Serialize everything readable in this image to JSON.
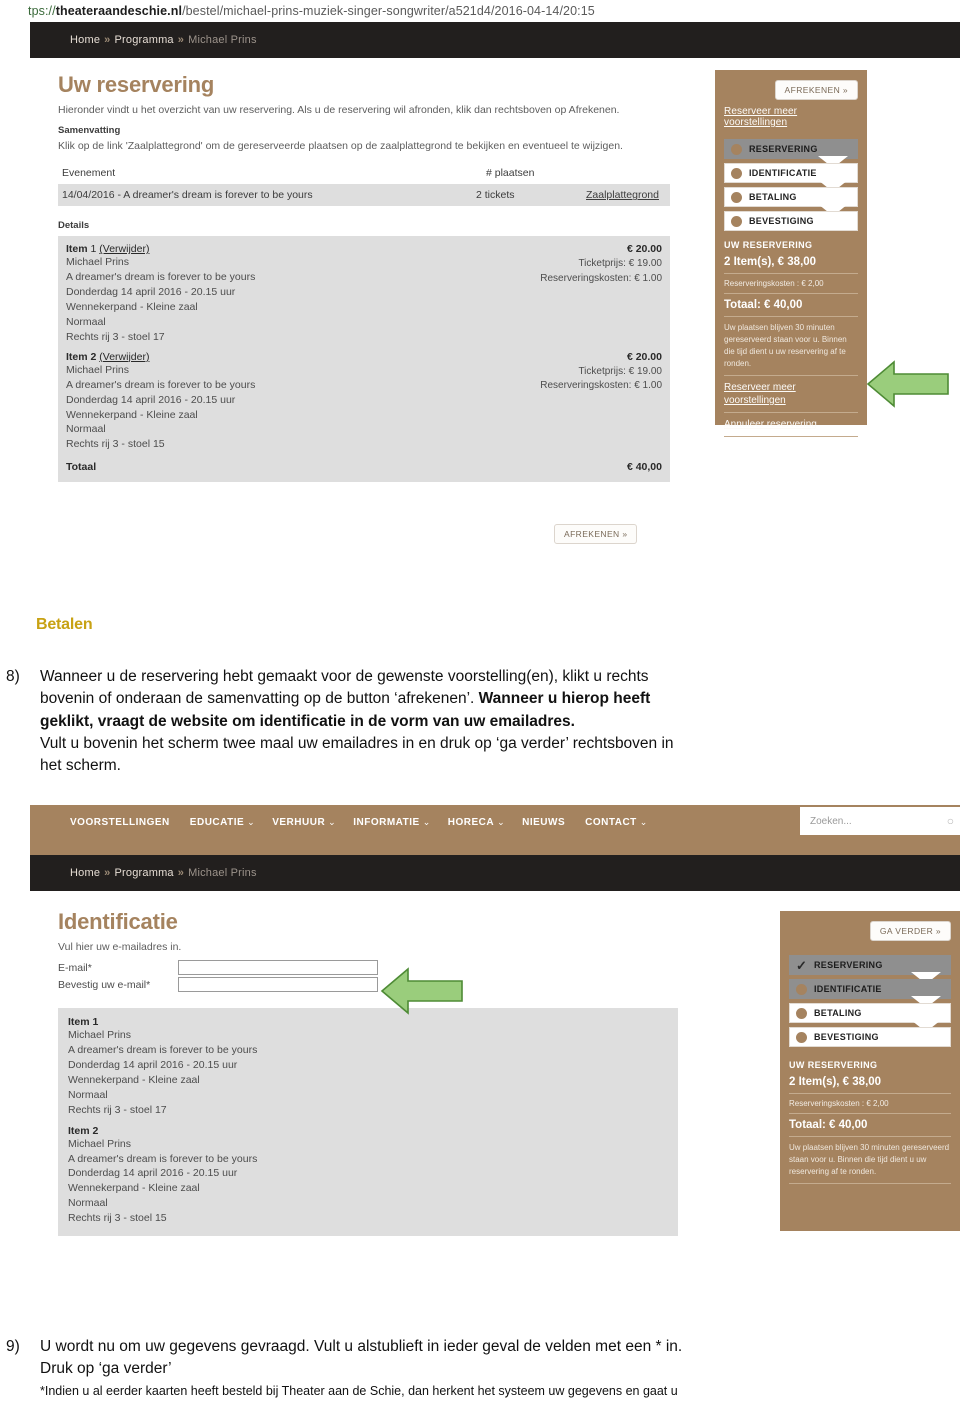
{
  "url": {
    "scheme": "tps://",
    "host": "theateraandeschie.nl",
    "path": "/bestel/michael-prins-muziek-singer-songwriter/a521d4/2016-04-14/20:15",
    "full": "tps://theateraandeschie.nl/bestel/michael-prins-muziek-singer-songwriter/a521d4/2016-04-14/20:15"
  },
  "breadcrumb": {
    "home": "Home",
    "sep": "»",
    "programma": "Programma",
    "current": "Michael Prins"
  },
  "screenshot1": {
    "title": "Uw reservering",
    "lead": "Hieronder vindt u het overzicht van uw reservering. Als u de reservering wil afronden, klik dan rechtsboven op Afrekenen.",
    "summary_label": "Samenvatting",
    "summary_text": "Klik op de link 'Zaalplattegrond' om de gereserveerde plaatsen op de zaalplattegrond te bekijken en eventueel te wijzigen.",
    "table": {
      "headers": [
        "Evenement",
        "# plaatsen"
      ],
      "row": {
        "event": "14/04/2016 - A dreamer's dream is forever to be yours",
        "seats": "2 tickets",
        "maplink": "Zaalplattegrond"
      }
    },
    "details_label": "Details",
    "items": [
      {
        "title_bold": "Item",
        "title_num": "1",
        "remove": "(Verwijder)",
        "price": "€ 20.00",
        "lines": [
          "Michael Prins",
          "A dreamer's dream is forever to be yours",
          "Donderdag 14 april 2016 - 20.15 uur",
          "Wennekerpand - Kleine zaal",
          "Normaal",
          "Rechts rij 3 - stoel 17"
        ],
        "ticketprice": "Ticketprijs: € 19.00",
        "reskosten": "Reserveringskosten: € 1.00"
      },
      {
        "title_bold": "Item 2",
        "title_num": "",
        "remove": "(Verwijder)",
        "price": "€ 20.00",
        "lines": [
          "Michael Prins",
          "A dreamer's dream is forever to be yours",
          "Donderdag 14 april 2016 - 20.15 uur",
          "Wennekerpand - Kleine zaal",
          "Normaal",
          "Rechts rij 3 - stoel 15"
        ],
        "ticketprice": "Ticketprijs: € 19.00",
        "reskosten": "Reserveringskosten: € 1.00"
      }
    ],
    "total_label": "Totaal",
    "total_value": "€ 40,00",
    "bottom_button": "AFREKENEN »",
    "sidebar": {
      "checkout_button": "AFREKENEN »",
      "more_link": "Reserveer meer voorstellingen",
      "steps": [
        {
          "label": "RESERVERING",
          "state": "active"
        },
        {
          "label": "IDENTIFICATIE",
          "state": "todo"
        },
        {
          "label": "BETALING",
          "state": "todo"
        },
        {
          "label": "BEVESTIGING",
          "state": "todo"
        }
      ],
      "summary_title": "UW RESERVERING",
      "items_line": "2 Item(s), € 38,00",
      "fees_line": "Reserveringskosten : € 2,00",
      "total_line": "Totaal: € 40,00",
      "note": "Uw plaatsen blijven 30 minuten gereserveerd staan voor u. Binnen die tijd dient u uw reservering af te ronden.",
      "link_more_1": "Reserveer meer",
      "link_more_2": "voorstellingen",
      "link_cancel": "Annuleer reservering"
    }
  },
  "body": {
    "heading": "Betalen",
    "step8": {
      "number": "8)",
      "line1_a": "Wanneer u de reservering hebt gemaakt voor de gewenste voorstelling(en), klikt u rechts",
      "line2_a": "bovenin of onderaan de samenvatting op de button ‘afrekenen’. ",
      "line2_b": "Wanneer u hierop heeft",
      "line3_b": "geklikt, vraagt de website om identificatie in de vorm van uw emailadres.",
      "line4": "Vult u bovenin het scherm twee maal uw emailadres in en druk op ‘ga verder’ rechtsboven in",
      "line5": "het scherm."
    },
    "step9": {
      "number": "9)",
      "line1": "U wordt nu om uw gegevens gevraagd. Vult u alstublieft in ieder geval de velden met een * in.",
      "line2": "Druk op ‘ga verder’",
      "footnote": "*Indien u al eerder kaarten heeft besteld bij Theater aan de Schie, dan herkent het systeem uw gegevens en gaat u"
    }
  },
  "screenshot2": {
    "nav": [
      {
        "label": "VOORSTELLINGEN",
        "caret": ""
      },
      {
        "label": "EDUCATIE",
        "caret": "⌄"
      },
      {
        "label": "VERHUUR",
        "caret": "⌄"
      },
      {
        "label": "INFORMATIE",
        "caret": "⌄"
      },
      {
        "label": "HORECA",
        "caret": "⌄"
      },
      {
        "label": "NIEUWS",
        "caret": ""
      },
      {
        "label": "CONTACT",
        "caret": "⌄"
      }
    ],
    "search_placeholder": "Zoeken...",
    "search_icon": "search-icon",
    "title": "Identificatie",
    "subtitle": "Vul hier uw e-mailadres in.",
    "fields": [
      {
        "label": "E-mail*",
        "value": ""
      },
      {
        "label": "Bevestig uw e-mail*",
        "value": ""
      }
    ],
    "items": [
      {
        "title": "Item 1",
        "lines": [
          "Michael Prins",
          "A dreamer's dream is forever to be yours",
          "Donderdag 14 april 2016 - 20.15 uur",
          "Wennekerpand - Kleine zaal",
          "Normaal",
          "Rechts rij 3 - stoel 17"
        ]
      },
      {
        "title": "Item 2",
        "lines": [
          "Michael Prins",
          "A dreamer's dream is forever to be yours",
          "Donderdag 14 april 2016 - 20.15 uur",
          "Wennekerpand - Kleine zaal",
          "Normaal",
          "Rechts rij 3 - stoel 15"
        ]
      }
    ],
    "sidebar": {
      "next_button": "GA VERDER »",
      "steps": [
        {
          "label": "RESERVERING",
          "state": "done"
        },
        {
          "label": "IDENTIFICATIE",
          "state": "active"
        },
        {
          "label": "BETALING",
          "state": "todo"
        },
        {
          "label": "BEVESTIGING",
          "state": "todo"
        }
      ],
      "check_glyph": "✓",
      "summary_title": "UW RESERVERING",
      "items_line": "2 Item(s), € 38,00",
      "fees_line": "Reserveringskosten : € 2,00",
      "total_line": "Totaal: € 40,00",
      "note": "Uw plaatsen blijven 30 minuten gereserveerd staan voor u. Binnen die tijd dient u uw reservering af te ronden."
    }
  },
  "colors": {
    "brand_brown": "#a5835f",
    "dark_bar": "#221f1e",
    "heading_yellow": "#c8a213",
    "panel_grey": "#dedede",
    "arrow_green": "#9acd7c",
    "arrow_green_border": "#4e8b35",
    "step_active_grey": "#8f8f8f"
  }
}
